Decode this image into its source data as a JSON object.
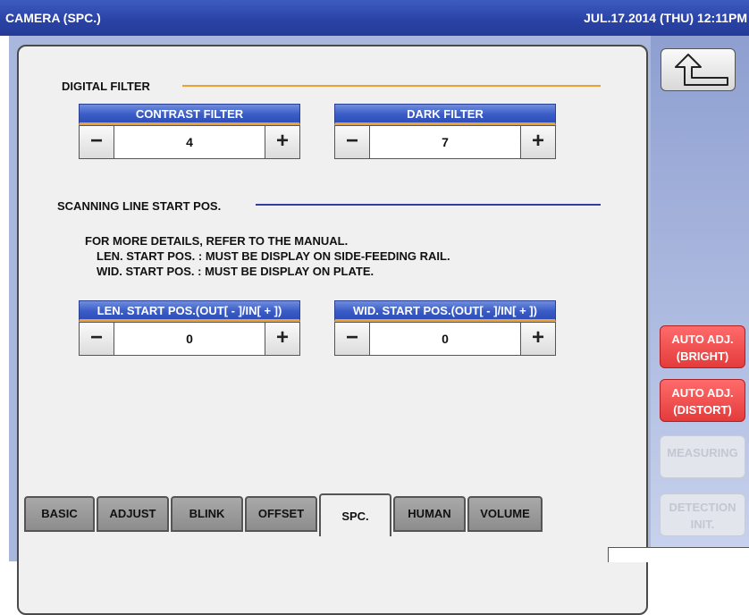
{
  "titlebar": {
    "title": "CAMERA (SPC.)",
    "clock": "JUL.17.2014 (THU) 12:11PM"
  },
  "digital_filter": {
    "label": "DIGITAL FILTER",
    "line_color": "#f0a030",
    "contrast": {
      "title": "CONTRAST FILTER",
      "value": "4",
      "minus": "−",
      "plus": "+"
    },
    "dark": {
      "title": "DARK FILTER",
      "value": "7",
      "minus": "−",
      "plus": "+"
    }
  },
  "scanning": {
    "label": "SCANNING LINE START POS.",
    "line_color": "#2e3fa0",
    "info": [
      "FOR MORE DETAILS, REFER TO THE MANUAL.",
      "LEN. START POS. : MUST BE DISPLAY ON SIDE-FEEDING RAIL.",
      "WID. START POS. : MUST BE DISPLAY ON PLATE."
    ],
    "len": {
      "title": "LEN. START POS.(OUT[ - ]/IN[ + ])",
      "value": "0",
      "minus": "−",
      "plus": "+"
    },
    "wid": {
      "title": "WID. START POS.(OUT[ - ]/IN[ + ])",
      "value": "0",
      "minus": "−",
      "plus": "+"
    }
  },
  "tabs": [
    "BASIC",
    "ADJUST",
    "BLINK",
    "OFFSET",
    "SPC.",
    "HUMAN",
    "VOLUME"
  ],
  "active_tab": "SPC.",
  "side": {
    "back_icon": "return-arrow-icon",
    "auto_bright": [
      "AUTO ADJ.",
      "(BRIGHT)"
    ],
    "auto_distort": [
      "AUTO ADJ.",
      "(DISTORT)"
    ],
    "measuring": "MEASURING",
    "detection_init": [
      "DETECTION",
      "INIT."
    ]
  },
  "colors": {
    "title_bar": "#2a43a6",
    "accent_red": "#e43b3b",
    "header_blue": "#3a5cc6"
  }
}
